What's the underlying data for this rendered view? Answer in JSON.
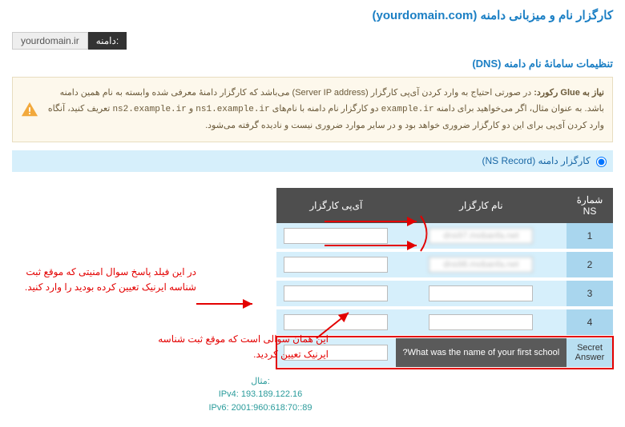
{
  "title_prefix": "کارگزار نام و میزبانی دامنه",
  "title_domain": "(yourdomain.com)",
  "domain_label": "دامنه:",
  "domain_value": "yourdomain.ir",
  "dns_settings_title": "تنظیمات سامانهٔ نام دامنه (DNS)",
  "notice_strong": "نیاز به Glue رکورد:",
  "notice_body": "در صورتی احتیاج به وارد کردن آی‌پی کارگزار (Server IP address) می‌باشد که کارگزار دامنهٔ معرفی شده وابسته به نام همین دامنه باشد. به عنوان مثال، اگر می‌خواهید برای دامنه ",
  "notice_code1": "example.ir",
  "notice_mid": " دو کارگزار نام دامنه با نام‌های ",
  "notice_code2": "ns1.example.ir",
  "notice_and": " و ",
  "notice_code3": "ns2.example.ir",
  "notice_tail": " تعریف کنید، آنگاه وارد کردن آی‌پی برای این دو کارگزار ضروری خواهد بود و در سایر موارد ضروری نیست و نادیده گرفته می‌شود.",
  "tab_label": "کارگزار دامنه (NS Record)",
  "th_num": "شمارهٔ NS",
  "th_name": "نام کارگزار",
  "th_ip": "آی‌پی کارگزار",
  "rows": [
    {
      "num": "1",
      "name": "dns97.mobanfa.net",
      "ip": ""
    },
    {
      "num": "2",
      "name": "dns98.mobanfa.net",
      "ip": ""
    },
    {
      "num": "3",
      "name": "",
      "ip": ""
    },
    {
      "num": "4",
      "name": "",
      "ip": ""
    }
  ],
  "secret_answer_label": "Secret Answer",
  "secret_question": "What was the name of your first school?",
  "secret_input": "",
  "example_label": "مثال:",
  "example_v4": "IPv4: 193.189.122.16",
  "example_v6": "IPv6: 2001:960:618:70::89",
  "annot_left": "در این فیلد پاسخ سوال امنیتی که موقع ثبت شناسه ایرنیک تعیین کرده بودید را وارد کنید.",
  "annot_bottom": "این همان سوالی است که موقع ثبت شناسه ایرنیک تعیین کردید."
}
